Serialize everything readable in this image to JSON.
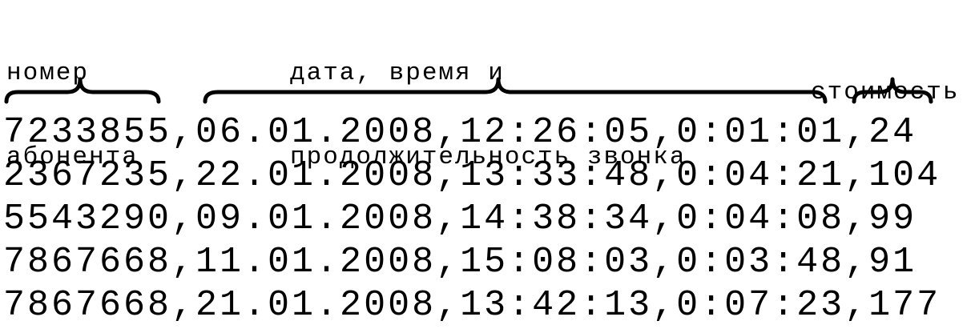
{
  "labels": {
    "subscriber": [
      "номер",
      "абонента"
    ],
    "datetime": [
      "дата, время и",
      "продолжительность звонка"
    ],
    "cost": [
      "стоимость"
    ]
  },
  "records": [
    "7233855,06.01.2008,12:26:05,0:01:01,24",
    "2367235,22.01.2008,13:33:48,0:04:21,104",
    "5543290,09.01.2008,14:38:34,0:04:08,99",
    "7867668,11.01.2008,15:08:03,0:03:48,91",
    "7867668,21.01.2008,13:42:13,0:07:23,177"
  ]
}
